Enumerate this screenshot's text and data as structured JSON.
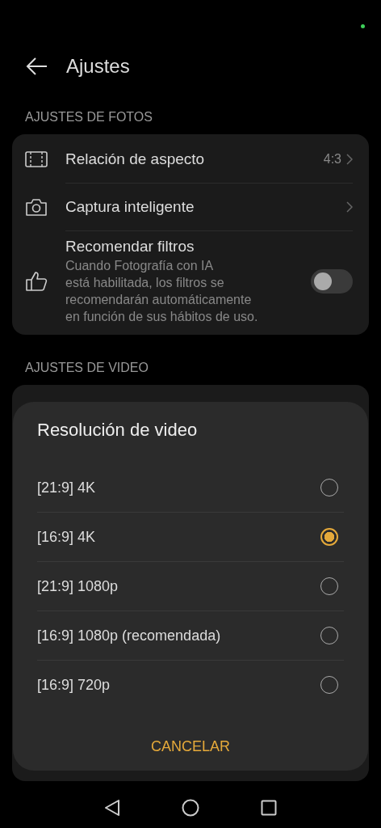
{
  "header": {
    "title": "Ajustes"
  },
  "photo_settings": {
    "heading": "AJUSTES DE FOTOS",
    "items": [
      {
        "kind": "link",
        "label": "Relación de aspecto",
        "value": "4:3"
      },
      {
        "kind": "link",
        "label": "Captura inteligente"
      },
      {
        "kind": "toggle",
        "label": "Recomendar filtros",
        "description": "Cuando Fotografía con IA\nestá habilitada, los filtros se\nrecomendarán automáticamente\nen función de sus hábitos de uso.",
        "on": false
      }
    ]
  },
  "video_settings": {
    "heading": "AJUSTES DE VIDEO"
  },
  "dialog": {
    "title": "Resolución de video",
    "options": [
      {
        "label": "[21:9] 4K",
        "selected": false
      },
      {
        "label": "[16:9] 4K",
        "selected": true
      },
      {
        "label": "[21:9] 1080p",
        "selected": false
      },
      {
        "label": "[16:9] 1080p (recomendada)",
        "selected": false
      },
      {
        "label": "[16:9] 720p",
        "selected": false
      }
    ],
    "cancel": "CANCELAR"
  }
}
